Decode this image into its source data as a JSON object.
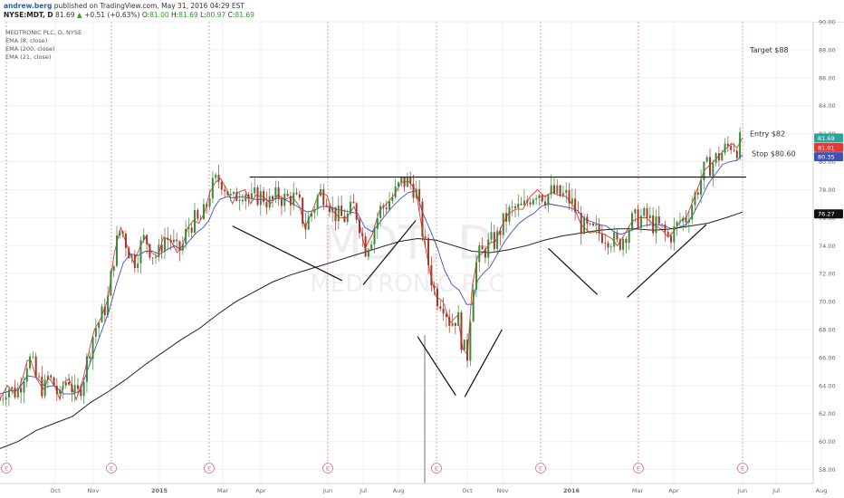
{
  "header": {
    "author": "andrew.berg",
    "published": "published on TradingView.com, May 31, 2016 04:29 EST",
    "symbol": "NYSE:MDT, D",
    "price": "81.69",
    "change": "+0.51 (+0.63%)",
    "ohlc": [
      {
        "k": "O:",
        "v": "81.00"
      },
      {
        "k": "H:",
        "v": "81.69"
      },
      {
        "k": "L:",
        "v": "80.97"
      },
      {
        "k": "C:",
        "v": "81.69"
      }
    ]
  },
  "watermark": {
    "ticker": "MDT, D",
    "name": "MEDTRONIC PLC"
  },
  "studies": [
    "MEDTRONIC PLC, D, NYSE",
    "EMA (8, close)",
    "EMA (200, close)",
    "EMA (21, close)"
  ],
  "colors": {
    "up": "#26a69a",
    "down": "#ef5350",
    "candle_up": "#3a8a3a",
    "candle_down": "#a03a2a",
    "ema8": "#e53935",
    "ema21": "#3f51b5",
    "ema200": "#222222",
    "event_line": "#e88a8a"
  },
  "chart_data": {
    "type": "line",
    "title": "MEDTRONIC PLC, D, NYSE",
    "y_range": [
      57,
      90
    ],
    "y_ticks": [
      "58.00",
      "60.00",
      "62.00",
      "64.00",
      "66.00",
      "68.00",
      "70.00",
      "72.00",
      "74.00",
      "76.00",
      "78.00",
      "80.00",
      "82.00",
      "84.00",
      "86.00",
      "88.00",
      "90.00"
    ],
    "x_ticks": [
      "Oct",
      "Nov",
      "2015",
      "Mar",
      "Apr",
      "Jun",
      "Jul",
      "Aug",
      "Oct",
      "Nov",
      "2016",
      "Mar",
      "Apr",
      "Jun",
      "Jul",
      "Aug"
    ],
    "series": [
      {
        "name": "EMA (8, close)",
        "values": [
          [
            0,
            63.0
          ],
          [
            8,
            64.0
          ],
          [
            15,
            63.5
          ],
          [
            21,
            63.8
          ],
          [
            26,
            64.8
          ],
          [
            30,
            65.8
          ],
          [
            34,
            65.8
          ],
          [
            40,
            64.5
          ],
          [
            45,
            64.0
          ],
          [
            49,
            63.7
          ],
          [
            53,
            64.6
          ],
          [
            60,
            64.0
          ],
          [
            66,
            63.0
          ],
          [
            70,
            64.2
          ],
          [
            76,
            64.5
          ],
          [
            84,
            63.0
          ],
          [
            92,
            64.6
          ],
          [
            100,
            67.0
          ],
          [
            104,
            68.0
          ],
          [
            111,
            68.8
          ],
          [
            119,
            70.2
          ],
          [
            126,
            73.5
          ],
          [
            133,
            75.3
          ],
          [
            140,
            74.0
          ],
          [
            147,
            72.8
          ],
          [
            155,
            74.0
          ],
          [
            160,
            74.6
          ],
          [
            167,
            73.5
          ],
          [
            174,
            73.2
          ],
          [
            180,
            74.6
          ],
          [
            188,
            74.4
          ],
          [
            195,
            73.5
          ],
          [
            201,
            74.0
          ],
          [
            207,
            75.3
          ],
          [
            213,
            75.8
          ],
          [
            219,
            75.6
          ],
          [
            225,
            76.3
          ],
          [
            231,
            77.8
          ],
          [
            237,
            78.5
          ],
          [
            243,
            78.8
          ],
          [
            250,
            78.0
          ],
          [
            256,
            77.0
          ],
          [
            262,
            77.8
          ],
          [
            270,
            78.0
          ],
          [
            276,
            77.0
          ],
          [
            282,
            77.6
          ],
          [
            290,
            77.5
          ],
          [
            298,
            77.0
          ],
          [
            306,
            77.6
          ],
          [
            314,
            77.3
          ],
          [
            322,
            77.5
          ],
          [
            330,
            76.8
          ],
          [
            336,
            75.3
          ],
          [
            344,
            76.5
          ],
          [
            352,
            77.8
          ],
          [
            360,
            77.6
          ],
          [
            366,
            76.5
          ],
          [
            374,
            76.0
          ],
          [
            382,
            76.0
          ],
          [
            390,
            76.8
          ],
          [
            396,
            75.6
          ],
          [
            402,
            73.8
          ],
          [
            410,
            74.8
          ],
          [
            418,
            76.5
          ],
          [
            426,
            77.0
          ],
          [
            434,
            77.6
          ],
          [
            442,
            78.5
          ],
          [
            450,
            78.6
          ],
          [
            458,
            78.0
          ],
          [
            466,
            74.8
          ],
          [
            474,
            72.0
          ],
          [
            480,
            70.4
          ],
          [
            488,
            70.0
          ],
          [
            496,
            68.5
          ],
          [
            504,
            69.0
          ],
          [
            510,
            66.6
          ],
          [
            515,
            66.2
          ],
          [
            520,
            71.0
          ],
          [
            526,
            73.2
          ],
          [
            532,
            73.5
          ],
          [
            540,
            74.2
          ],
          [
            546,
            74.3
          ],
          [
            552,
            75.3
          ],
          [
            560,
            76.3
          ],
          [
            568,
            76.6
          ],
          [
            576,
            76.6
          ],
          [
            584,
            77.5
          ],
          [
            592,
            78.0
          ],
          [
            600,
            77.5
          ],
          [
            608,
            77.8
          ],
          [
            616,
            77.6
          ],
          [
            624,
            77.5
          ],
          [
            632,
            76.8
          ],
          [
            640,
            75.5
          ],
          [
            650,
            74.9
          ],
          [
            656,
            75.0
          ],
          [
            666,
            74.8
          ],
          [
            674,
            74.5
          ],
          [
            680,
            74.0
          ],
          [
            688,
            74.8
          ],
          [
            696,
            75.7
          ],
          [
            704,
            76.0
          ],
          [
            712,
            76.0
          ],
          [
            720,
            75.5
          ],
          [
            728,
            75.2
          ],
          [
            736,
            74.6
          ],
          [
            742,
            75.0
          ],
          [
            750,
            75.8
          ],
          [
            756,
            76.0
          ],
          [
            762,
            77.0
          ],
          [
            768,
            78.0
          ],
          [
            776,
            79.4
          ],
          [
            786,
            80.0
          ],
          [
            796,
            80.7
          ],
          [
            806,
            81.3
          ],
          [
            812,
            81.0
          ],
          [
            818,
            81.7
          ]
        ]
      },
      {
        "name": "EMA (21, close)",
        "values": [
          [
            0,
            63.4
          ],
          [
            10,
            63.6
          ],
          [
            20,
            63.7
          ],
          [
            30,
            64.7
          ],
          [
            40,
            64.6
          ],
          [
            50,
            63.9
          ],
          [
            60,
            64.0
          ],
          [
            70,
            63.4
          ],
          [
            80,
            63.4
          ],
          [
            88,
            63.6
          ],
          [
            96,
            65.0
          ],
          [
            104,
            66.5
          ],
          [
            112,
            67.9
          ],
          [
            120,
            69.3
          ],
          [
            128,
            71.2
          ],
          [
            136,
            72.8
          ],
          [
            144,
            73.4
          ],
          [
            152,
            73.3
          ],
          [
            160,
            73.6
          ],
          [
            168,
            73.6
          ],
          [
            176,
            73.4
          ],
          [
            184,
            73.7
          ],
          [
            192,
            74.0
          ],
          [
            200,
            73.7
          ],
          [
            208,
            74.3
          ],
          [
            216,
            74.9
          ],
          [
            224,
            75.3
          ],
          [
            230,
            75.8
          ],
          [
            236,
            76.7
          ],
          [
            242,
            77.3
          ],
          [
            250,
            77.5
          ],
          [
            258,
            77.4
          ],
          [
            266,
            77.5
          ],
          [
            274,
            77.4
          ],
          [
            282,
            77.3
          ],
          [
            290,
            77.3
          ],
          [
            298,
            77.2
          ],
          [
            306,
            77.4
          ],
          [
            314,
            77.3
          ],
          [
            322,
            77.0
          ],
          [
            330,
            76.7
          ],
          [
            338,
            76.4
          ],
          [
            346,
            76.5
          ],
          [
            354,
            76.8
          ],
          [
            362,
            76.8
          ],
          [
            370,
            76.6
          ],
          [
            378,
            76.5
          ],
          [
            386,
            76.4
          ],
          [
            394,
            76.3
          ],
          [
            402,
            75.3
          ],
          [
            410,
            75.0
          ],
          [
            418,
            75.6
          ],
          [
            426,
            76.3
          ],
          [
            434,
            76.9
          ],
          [
            442,
            77.4
          ],
          [
            450,
            77.8
          ],
          [
            458,
            77.9
          ],
          [
            466,
            76.3
          ],
          [
            474,
            75.1
          ],
          [
            482,
            73.8
          ],
          [
            490,
            72.2
          ],
          [
            498,
            71.2
          ],
          [
            506,
            70.8
          ],
          [
            514,
            69.8
          ],
          [
            520,
            69.8
          ],
          [
            526,
            71.5
          ],
          [
            532,
            72.0
          ],
          [
            540,
            72.5
          ],
          [
            548,
            73.4
          ],
          [
            556,
            74.3
          ],
          [
            564,
            75.0
          ],
          [
            572,
            75.6
          ],
          [
            580,
            76.0
          ],
          [
            588,
            76.3
          ],
          [
            596,
            76.8
          ],
          [
            604,
            77.0
          ],
          [
            612,
            76.9
          ],
          [
            620,
            76.8
          ],
          [
            628,
            76.7
          ],
          [
            636,
            76.5
          ],
          [
            644,
            75.9
          ],
          [
            652,
            75.7
          ],
          [
            660,
            75.5
          ],
          [
            668,
            75.4
          ],
          [
            676,
            75.0
          ],
          [
            684,
            74.8
          ],
          [
            692,
            75.0
          ],
          [
            700,
            75.2
          ],
          [
            708,
            75.4
          ],
          [
            716,
            75.5
          ],
          [
            724,
            75.5
          ],
          [
            732,
            75.4
          ],
          [
            740,
            75.2
          ],
          [
            748,
            75.3
          ],
          [
            756,
            75.5
          ],
          [
            764,
            76.3
          ],
          [
            772,
            77.3
          ],
          [
            780,
            78.4
          ],
          [
            788,
            79.1
          ],
          [
            796,
            79.8
          ],
          [
            804,
            80.0
          ],
          [
            812,
            80.1
          ],
          [
            818,
            80.5
          ]
        ]
      },
      {
        "name": "EMA (200, close)",
        "values": [
          [
            0,
            59.5
          ],
          [
            20,
            60.0
          ],
          [
            40,
            60.8
          ],
          [
            60,
            61.3
          ],
          [
            80,
            61.8
          ],
          [
            100,
            62.8
          ],
          [
            120,
            63.6
          ],
          [
            140,
            64.5
          ],
          [
            160,
            65.5
          ],
          [
            180,
            66.4
          ],
          [
            200,
            67.3
          ],
          [
            220,
            68.1
          ],
          [
            240,
            69.1
          ],
          [
            260,
            70.0
          ],
          [
            280,
            70.7
          ],
          [
            300,
            71.4
          ],
          [
            320,
            71.9
          ],
          [
            340,
            72.3
          ],
          [
            360,
            72.7
          ],
          [
            380,
            73.1
          ],
          [
            400,
            73.5
          ],
          [
            420,
            73.9
          ],
          [
            440,
            74.3
          ],
          [
            460,
            74.5
          ],
          [
            480,
            74.4
          ],
          [
            500,
            74.0
          ],
          [
            520,
            73.6
          ],
          [
            540,
            73.5
          ],
          [
            560,
            73.7
          ],
          [
            580,
            74.0
          ],
          [
            600,
            74.4
          ],
          [
            620,
            74.7
          ],
          [
            640,
            74.9
          ],
          [
            660,
            75.1
          ],
          [
            680,
            75.2
          ],
          [
            700,
            75.2
          ],
          [
            720,
            75.1
          ],
          [
            740,
            75.2
          ],
          [
            760,
            75.4
          ],
          [
            780,
            75.6
          ],
          [
            800,
            76.0
          ],
          [
            818,
            76.4
          ]
        ]
      }
    ],
    "price_labels": [
      {
        "text": "81.69",
        "value": 81.69,
        "color": "#26a69a"
      },
      {
        "text": "81.01",
        "value": 81.01,
        "color": "#e53935"
      },
      {
        "text": "80.35",
        "value": 80.35,
        "color": "#3f51b5"
      },
      {
        "text": "76.27",
        "value": 76.27,
        "color": "#111111"
      }
    ],
    "annotations": [
      {
        "text": "Target $88",
        "value": 88.0
      },
      {
        "text": "Entry $82",
        "value": 82.0
      },
      {
        "text": "Stop $80.60",
        "value": 80.6
      }
    ],
    "neckline": {
      "value": 78.9
    },
    "event_marker": "E"
  }
}
